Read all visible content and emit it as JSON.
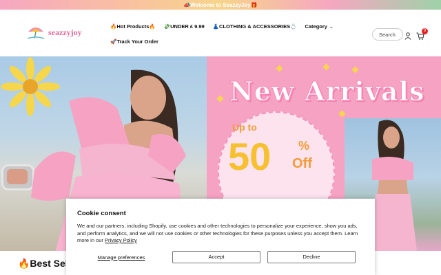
{
  "announcement": {
    "text": "📣Welcome to SeazzyJoy🎁"
  },
  "logo": {
    "name": "seazzyjoy"
  },
  "nav": {
    "items": [
      {
        "label": "🔥Hot Products🔥"
      },
      {
        "label": "💸UNDER £ 9.99"
      },
      {
        "label": "👗CLOTHING & ACCESSORIES💍"
      },
      {
        "label": "Category"
      }
    ],
    "second_row": "🚀Track Your Order"
  },
  "search": {
    "placeholder": "Search"
  },
  "cart": {
    "count": "0"
  },
  "hero": {
    "headline": "New Arrivals",
    "up_to": "Up to",
    "discount": "50",
    "percent": "%",
    "off": "Off"
  },
  "section": {
    "title": "🔥Best Sel"
  },
  "cookie": {
    "title": "Cookie consent",
    "body": "We and our partners, including Shopify, use cookies and other technologies to personalize your experience, show you ads, and perform analytics, and we will not use cookies or other technologies for these purposes unless you accept them. Learn more in our ",
    "policy_link": "Privacy Policy",
    "manage_label": "Manage preferences",
    "accept_label": "Accept",
    "decline_label": "Decline"
  },
  "colors": {
    "accent_pink": "#f6a3c3",
    "discount_yellow": "#f6c030",
    "badge_red": "#e41f1f"
  }
}
